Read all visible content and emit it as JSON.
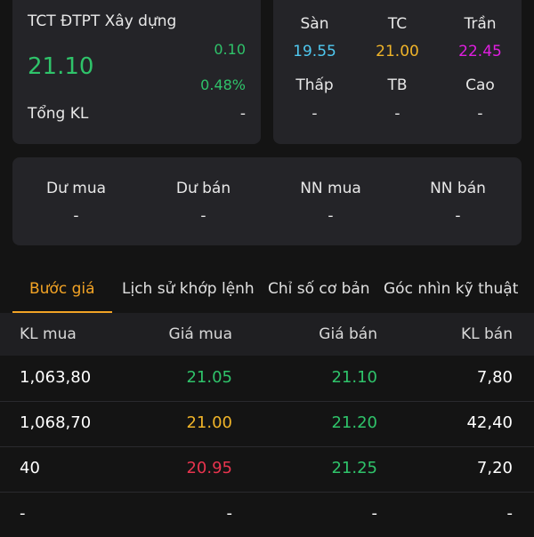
{
  "stock": {
    "name": "TCT ĐTPT Xây dựng",
    "price": "21.10",
    "change": "0.10",
    "change_pct": "0.48%",
    "volume_label": "Tổng KL",
    "volume_value": "-"
  },
  "price_range": {
    "floor_label": "Sàn",
    "floor": "19.55",
    "ref_label": "TC",
    "ref": "21.00",
    "ceiling_label": "Trần",
    "ceiling": "22.45",
    "low_label": "Thấp",
    "low": "-",
    "avg_label": "TB",
    "avg": "-",
    "high_label": "Cao",
    "high": "-"
  },
  "flow": {
    "buy_remaining_label": "Dư mua",
    "buy_remaining": "-",
    "sell_remaining_label": "Dư bán",
    "sell_remaining": "-",
    "foreign_buy_label": "NN mua",
    "foreign_buy": "-",
    "foreign_sell_label": "NN bán",
    "foreign_sell": "-"
  },
  "tabs": [
    {
      "label": "Bước giá",
      "active": true
    },
    {
      "label": "Lịch sử khớp lệnh",
      "active": false
    },
    {
      "label": "Chỉ số cơ bản",
      "active": false
    },
    {
      "label": "Góc nhìn kỹ thuật",
      "active": false
    }
  ],
  "order_book": {
    "headers": [
      "KL mua",
      "Giá mua",
      "Giá bán",
      "KL bán"
    ],
    "rows": [
      {
        "bid_vol": "1,063,80",
        "bid": "21.05",
        "ask": "21.10",
        "ask_vol": "7,80"
      },
      {
        "bid_vol": "1,068,70",
        "bid": "21.00",
        "ask": "21.20",
        "ask_vol": "42,40"
      },
      {
        "bid_vol": "40",
        "bid": "20.95",
        "ask": "21.25",
        "ask_vol": "7,20"
      },
      {
        "bid_vol": "-",
        "bid": "-",
        "ask": "-",
        "ask_vol": "-"
      }
    ]
  },
  "colors": {
    "up": "#2fc36a",
    "reference": "#f0b429",
    "down": "#e8344e",
    "floor": "#4fc8f0",
    "ceiling": "#e01ee0",
    "accent": "#f2a325"
  }
}
